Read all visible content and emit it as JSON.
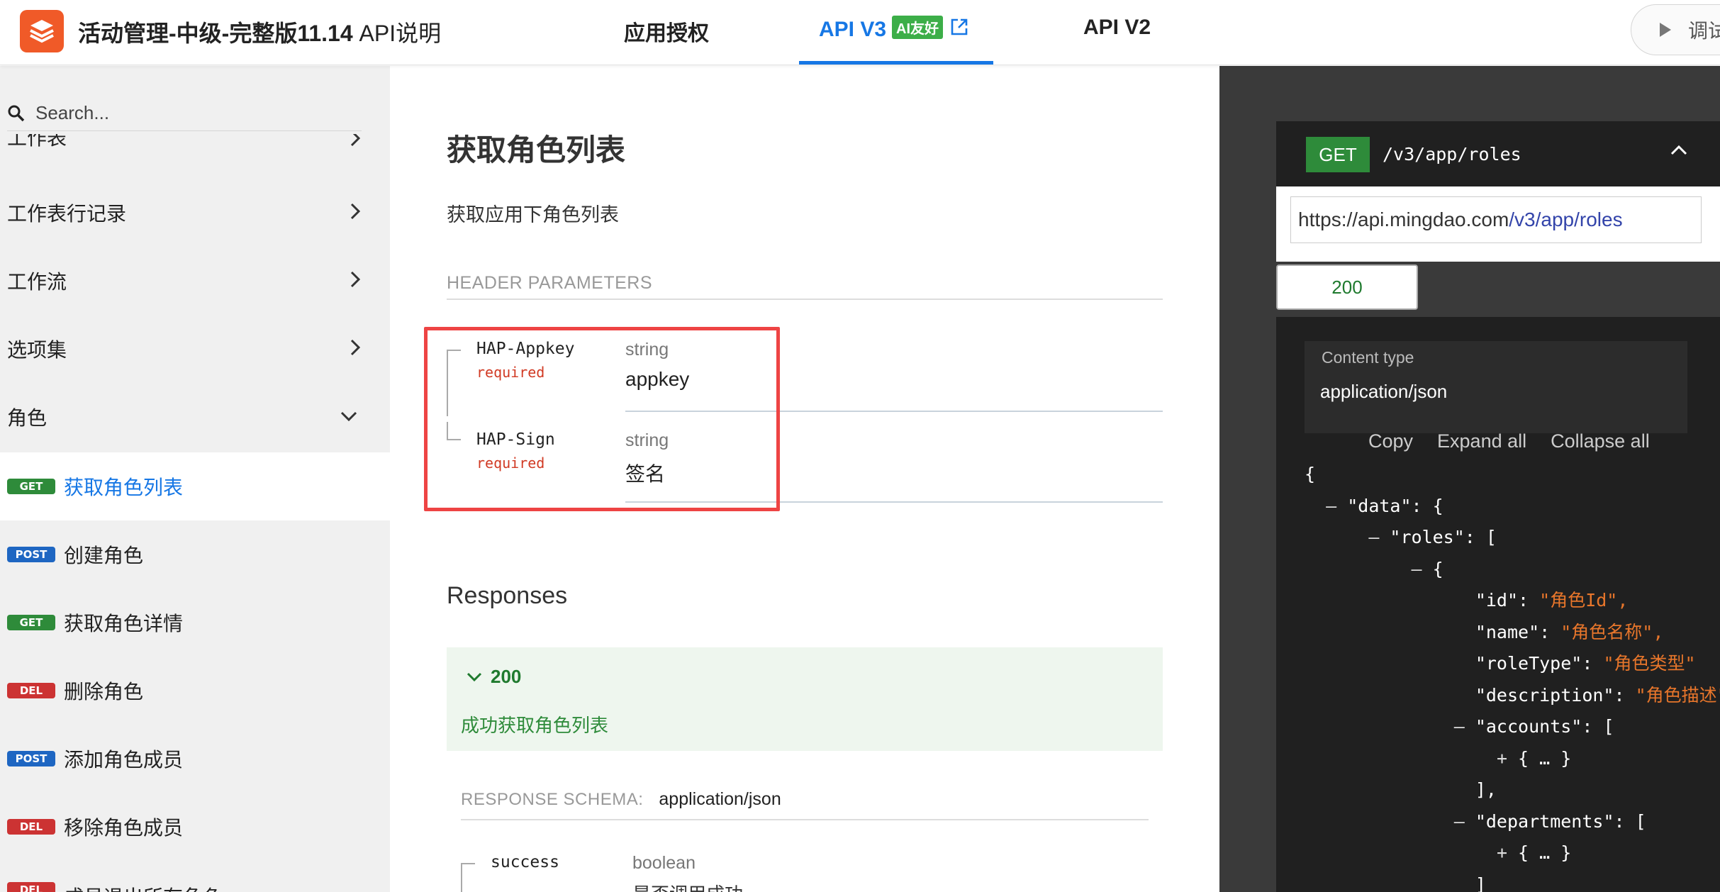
{
  "header": {
    "title_bold": "活动管理-中级-完整版11.14",
    "title_light": " API说明",
    "tabs": [
      {
        "label": "应用授权"
      },
      {
        "label": "API V3",
        "badge": "AI友好"
      },
      {
        "label": "API V2"
      }
    ],
    "debug_label": "调试"
  },
  "sidebar": {
    "search_placeholder": "Search...",
    "partial_top": "工作表",
    "groups": [
      {
        "label": "工作表行记录",
        "icon": "chevron-right-icon"
      },
      {
        "label": "工作流",
        "icon": "chevron-right-icon"
      },
      {
        "label": "选项集",
        "icon": "chevron-right-icon"
      },
      {
        "label": "角色",
        "icon": "chevron-down-icon"
      }
    ],
    "endpoints": [
      {
        "method": "GET",
        "label": "获取角色列表",
        "selected": true
      },
      {
        "method": "POST",
        "label": "创建角色"
      },
      {
        "method": "GET",
        "label": "获取角色详情"
      },
      {
        "method": "DEL",
        "label": "删除角色"
      },
      {
        "method": "POST",
        "label": "添加角色成员"
      },
      {
        "method": "DEL",
        "label": "移除角色成员"
      },
      {
        "method": "DEL",
        "label": "成员退出所有角色"
      }
    ]
  },
  "main": {
    "title": "获取角色列表",
    "description": "获取应用下角色列表",
    "header_params_label": "HEADER PARAMETERS",
    "header_params": [
      {
        "name": "HAP-Appkey",
        "required": "required",
        "type": "string",
        "desc": "appkey"
      },
      {
        "name": "HAP-Sign",
        "required": "required",
        "type": "string",
        "desc": "签名"
      }
    ],
    "responses_title": "Responses",
    "response": {
      "code": "200",
      "desc": "成功获取角色列表"
    },
    "schema_label": "RESPONSE SCHEMA:",
    "schema_type": "application/json",
    "schema_params": [
      {
        "name": "success",
        "type": "boolean",
        "desc": "是否调用成功"
      }
    ]
  },
  "request": {
    "method": "GET",
    "path": "/v3/app/roles",
    "url_base": "https://api.mingdao.com",
    "url_path": "/v3/app/roles",
    "status_tab": "200",
    "content_type_label": "Content type",
    "content_type": "application/json",
    "actions": [
      "Copy",
      "Expand all",
      "Collapse all"
    ],
    "json_lines": [
      "{",
      "  – \"data\": {",
      "      – \"roles\": [",
      "          – {",
      "                \"id\": \"角色Id\",",
      "                \"name\": \"角色名称\",",
      "                \"roleType\": \"角色类型\"",
      "                \"description\": \"角色描述\"",
      "              – \"accounts\": [",
      "                  + { … }",
      "                ],",
      "              – \"departments\": [",
      "                  + { … }",
      "                ]"
    ]
  },
  "colors": {
    "accent": "#1677e5",
    "get": "#2e8b3a",
    "post": "#1e66c2",
    "del": "#cc3333",
    "highlight": "#ee4444",
    "json_string": "#e8762b"
  }
}
